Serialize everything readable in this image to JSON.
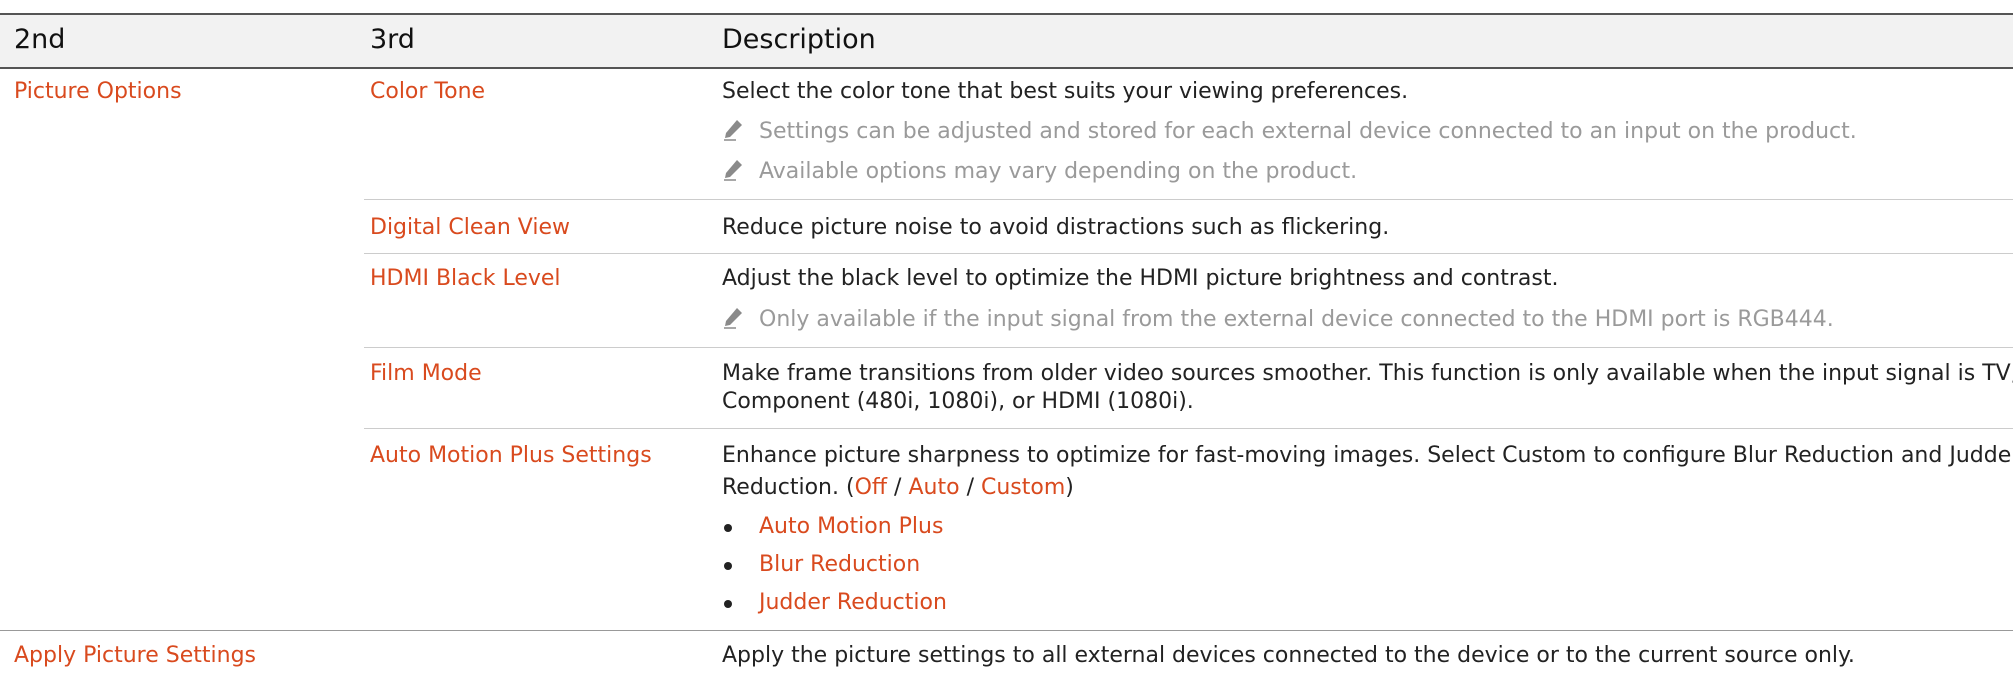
{
  "table": {
    "headers": {
      "col1": "2nd",
      "col2": "3rd",
      "col3": "Description"
    },
    "section1": {
      "name": "Picture Options",
      "rows": {
        "color_tone": {
          "label": "Color Tone",
          "desc": "Select the color tone that best suits your viewing preferences.",
          "notes": [
            "Settings can be adjusted and stored for each external device connected to an input on the product.",
            "Available options may vary depending on the product."
          ]
        },
        "digital_clean_view": {
          "label": "Digital Clean View",
          "desc": "Reduce picture noise to avoid distractions such as flickering."
        },
        "hdmi_black_level": {
          "label": "HDMI Black Level",
          "desc": "Adjust the black level to optimize the HDMI picture brightness and contrast.",
          "notes": [
            "Only available if the input signal from the external device connected to the HDMI port is RGB444."
          ]
        },
        "film_mode": {
          "label": "Film Mode",
          "desc_line1": "Make frame transitions from older video sources smoother. This function is only available when the input signal is TV, AV,",
          "desc_line2": "Component (480i, 1080i), or HDMI (1080i)."
        },
        "auto_motion_plus": {
          "label": "Auto Motion Plus Settings",
          "desc_line1": "Enhance picture sharpness to optimize for fast-moving images. Select Custom to configure Blur Reduction and Judder",
          "desc_line2_prefix": "Reduction. (",
          "opt_off": "Off",
          "slash": "/",
          "opt_auto": "Auto",
          "opt_custom": "Custom",
          "desc_line2_suffix": ")",
          "bullets": [
            "Auto Motion Plus",
            "Blur Reduction",
            "Judder Reduction"
          ]
        }
      }
    },
    "section2": {
      "name": "Apply Picture Settings",
      "desc": "Apply the picture settings to all external devices connected to the device or to the current source only."
    }
  },
  "colors": {
    "accent": "#d94a1e",
    "text": "#222222",
    "note": "#9a9a9a",
    "header_bg": "#f2f2f2"
  }
}
